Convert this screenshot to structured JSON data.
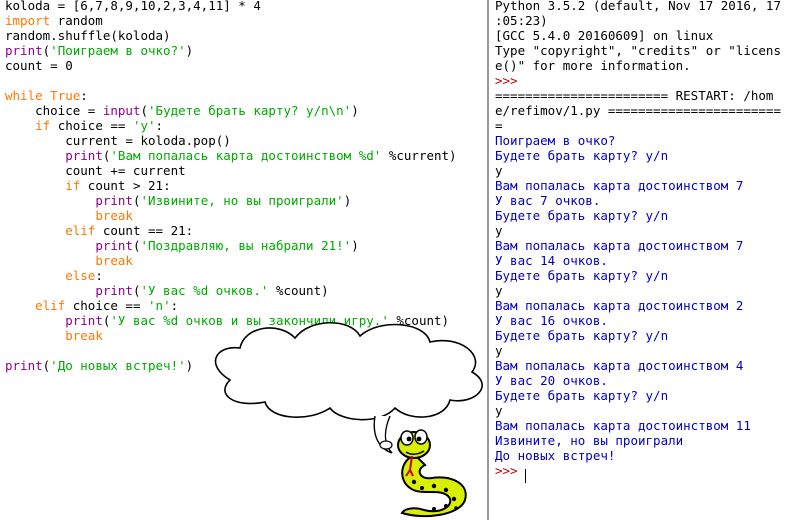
{
  "editor": {
    "code_lines": [
      [
        {
          "t": "koloda = [6,7,8,9,10,2,3,4,11] * 4",
          "c": ""
        }
      ],
      [
        {
          "t": "import",
          "c": "kw"
        },
        {
          "t": " random",
          "c": ""
        }
      ],
      [
        {
          "t": "random.shuffle(koloda)",
          "c": ""
        }
      ],
      [
        {
          "t": "print",
          "c": "bi"
        },
        {
          "t": "(",
          "c": ""
        },
        {
          "t": "'Поиграем в очко?'",
          "c": "str"
        },
        {
          "t": ")",
          "c": ""
        }
      ],
      [
        {
          "t": "count = 0",
          "c": ""
        }
      ],
      [],
      [
        {
          "t": "while",
          "c": "kw"
        },
        {
          "t": " ",
          "c": ""
        },
        {
          "t": "True",
          "c": "kw"
        },
        {
          "t": ":",
          "c": ""
        }
      ],
      [
        {
          "t": "    choice = ",
          "c": ""
        },
        {
          "t": "input",
          "c": "bi"
        },
        {
          "t": "(",
          "c": ""
        },
        {
          "t": "'Будете брать карту? y/n\\n'",
          "c": "str"
        },
        {
          "t": ")",
          "c": ""
        }
      ],
      [
        {
          "t": "    ",
          "c": ""
        },
        {
          "t": "if",
          "c": "kw"
        },
        {
          "t": " choice == ",
          "c": ""
        },
        {
          "t": "'y'",
          "c": "str"
        },
        {
          "t": ":",
          "c": ""
        }
      ],
      [
        {
          "t": "        current = koloda.pop()",
          "c": ""
        }
      ],
      [
        {
          "t": "        ",
          "c": ""
        },
        {
          "t": "print",
          "c": "bi"
        },
        {
          "t": "(",
          "c": ""
        },
        {
          "t": "'Вам попалась карта достоинством %d'",
          "c": "str"
        },
        {
          "t": " %current)",
          "c": ""
        }
      ],
      [
        {
          "t": "        count += current",
          "c": ""
        }
      ],
      [
        {
          "t": "        ",
          "c": ""
        },
        {
          "t": "if",
          "c": "kw"
        },
        {
          "t": " count > 21:",
          "c": ""
        }
      ],
      [
        {
          "t": "            ",
          "c": ""
        },
        {
          "t": "print",
          "c": "bi"
        },
        {
          "t": "(",
          "c": ""
        },
        {
          "t": "'Извините, но вы проиграли'",
          "c": "str"
        },
        {
          "t": ")",
          "c": ""
        }
      ],
      [
        {
          "t": "            ",
          "c": ""
        },
        {
          "t": "break",
          "c": "kw"
        }
      ],
      [
        {
          "t": "        ",
          "c": ""
        },
        {
          "t": "elif",
          "c": "kw"
        },
        {
          "t": " count == 21:",
          "c": ""
        }
      ],
      [
        {
          "t": "            ",
          "c": ""
        },
        {
          "t": "print",
          "c": "bi"
        },
        {
          "t": "(",
          "c": ""
        },
        {
          "t": "'Поздравляю, вы набрали 21!'",
          "c": "str"
        },
        {
          "t": ")",
          "c": ""
        }
      ],
      [
        {
          "t": "            ",
          "c": ""
        },
        {
          "t": "break",
          "c": "kw"
        }
      ],
      [
        {
          "t": "        ",
          "c": ""
        },
        {
          "t": "else",
          "c": "kw"
        },
        {
          "t": ":",
          "c": ""
        }
      ],
      [
        {
          "t": "            ",
          "c": ""
        },
        {
          "t": "print",
          "c": "bi"
        },
        {
          "t": "(",
          "c": ""
        },
        {
          "t": "'У вас %d очков.'",
          "c": "str"
        },
        {
          "t": " %count)",
          "c": ""
        }
      ],
      [
        {
          "t": "    ",
          "c": ""
        },
        {
          "t": "elif",
          "c": "kw"
        },
        {
          "t": " choice == ",
          "c": ""
        },
        {
          "t": "'n'",
          "c": "str"
        },
        {
          "t": ":",
          "c": ""
        }
      ],
      [
        {
          "t": "        ",
          "c": ""
        },
        {
          "t": "print",
          "c": "bi"
        },
        {
          "t": "(",
          "c": ""
        },
        {
          "t": "'У вас %d очков и вы закончили игру.'",
          "c": "str"
        },
        {
          "t": " %count)",
          "c": ""
        }
      ],
      [
        {
          "t": "        ",
          "c": ""
        },
        {
          "t": "break",
          "c": "kw"
        }
      ],
      [],
      [
        {
          "t": "print",
          "c": "bi"
        },
        {
          "t": "(",
          "c": ""
        },
        {
          "t": "'До новых встреч!'",
          "c": "str"
        },
        {
          "t": ")",
          "c": ""
        }
      ]
    ]
  },
  "shell": {
    "lines": [
      [
        {
          "t": "Python 3.5.2 (default, Nov 17 2016, 17",
          "c": ""
        }
      ],
      [
        {
          "t": ":05:23)",
          "c": ""
        }
      ],
      [
        {
          "t": "[GCC 5.4.0 20160609] on linux",
          "c": ""
        }
      ],
      [
        {
          "t": "Type \"copyright\", \"credits\" or \"licens",
          "c": ""
        }
      ],
      [
        {
          "t": "e()\" for more information.",
          "c": ""
        }
      ],
      [
        {
          "t": ">>> ",
          "c": "prompt"
        }
      ],
      [
        {
          "t": "======================= RESTART: /hom",
          "c": ""
        }
      ],
      [
        {
          "t": "e/refimov/1.py =======================",
          "c": ""
        }
      ],
      [
        {
          "t": "=",
          "c": ""
        }
      ],
      [
        {
          "t": "Поиграем в очко?",
          "c": "out"
        }
      ],
      [
        {
          "t": "Будете брать карту? y/n",
          "c": "out"
        }
      ],
      [
        {
          "t": "y",
          "c": "inp"
        }
      ],
      [
        {
          "t": "Вам попалась карта достоинством 7",
          "c": "out"
        }
      ],
      [
        {
          "t": "У вас 7 очков.",
          "c": "out"
        }
      ],
      [
        {
          "t": "Будете брать карту? y/n",
          "c": "out"
        }
      ],
      [
        {
          "t": "y",
          "c": "inp"
        }
      ],
      [
        {
          "t": "Вам попалась карта достоинством 7",
          "c": "out"
        }
      ],
      [
        {
          "t": "У вас 14 очков.",
          "c": "out"
        }
      ],
      [
        {
          "t": "Будете брать карту? y/n",
          "c": "out"
        }
      ],
      [
        {
          "t": "y",
          "c": "inp"
        }
      ],
      [
        {
          "t": "Вам попалась карта достоинством 2",
          "c": "out"
        }
      ],
      [
        {
          "t": "У вас 16 очков.",
          "c": "out"
        }
      ],
      [
        {
          "t": "Будете брать карту? y/n",
          "c": "out"
        }
      ],
      [
        {
          "t": "y",
          "c": "inp"
        }
      ],
      [
        {
          "t": "Вам попалась карта достоинством 4",
          "c": "out"
        }
      ],
      [
        {
          "t": "У вас 20 очков.",
          "c": "out"
        }
      ],
      [
        {
          "t": "Будете брать карту? y/n",
          "c": "out"
        }
      ],
      [
        {
          "t": "y",
          "c": "inp"
        }
      ],
      [
        {
          "t": "Вам попалась карта достоинством 11",
          "c": "out"
        }
      ],
      [
        {
          "t": "Извините, но вы проиграли",
          "c": "out"
        }
      ],
      [
        {
          "t": "До новых встреч!",
          "c": "out"
        }
      ],
      [
        {
          "t": ">>> ",
          "c": "prompt"
        }
      ]
    ]
  },
  "colors": {
    "keyword": "#ff7700",
    "builtin": "#900090",
    "string": "#00aa00",
    "shell_output": "#0000c0",
    "prompt": "#c00000",
    "snake_body": "#d8f000"
  },
  "icons": {
    "mascot": "python-snake-mascot",
    "speech": "speech-bubble"
  }
}
